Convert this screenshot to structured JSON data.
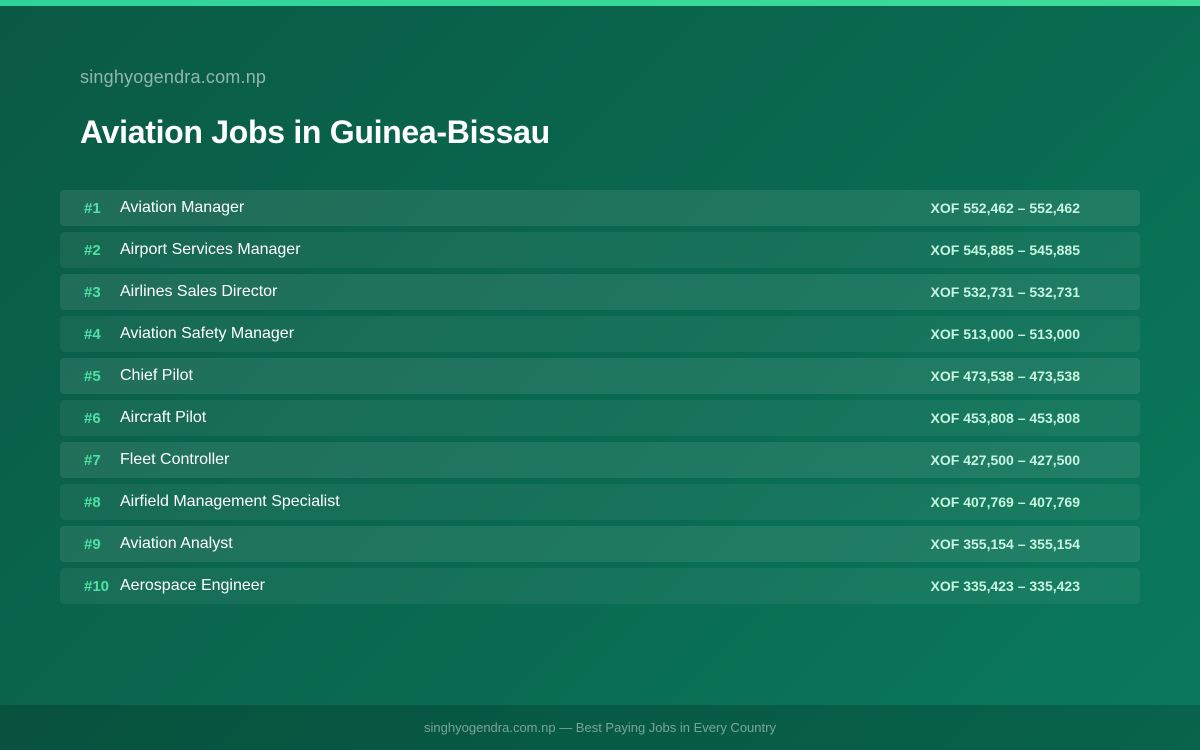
{
  "header": {
    "site_name": "singhyogendra.com.np",
    "title": "Aviation Jobs in Guinea-Bissau"
  },
  "jobs": [
    {
      "rank": "#1",
      "title": "Aviation Manager",
      "salary": "XOF 552,462 – 552,462"
    },
    {
      "rank": "#2",
      "title": "Airport Services Manager",
      "salary": "XOF 545,885 – 545,885"
    },
    {
      "rank": "#3",
      "title": "Airlines Sales Director",
      "salary": "XOF 532,731 – 532,731"
    },
    {
      "rank": "#4",
      "title": "Aviation Safety Manager",
      "salary": "XOF 513,000 – 513,000"
    },
    {
      "rank": "#5",
      "title": "Chief Pilot",
      "salary": "XOF 473,538 – 473,538"
    },
    {
      "rank": "#6",
      "title": "Aircraft Pilot",
      "salary": "XOF 453,808 – 453,808"
    },
    {
      "rank": "#7",
      "title": "Fleet Controller",
      "salary": "XOF 427,500 – 427,500"
    },
    {
      "rank": "#8",
      "title": "Airfield Management Specialist",
      "salary": "XOF 407,769 – 407,769"
    },
    {
      "rank": "#9",
      "title": "Aviation Analyst",
      "salary": "XOF 355,154 – 355,154"
    },
    {
      "rank": "#10",
      "title": "Aerospace Engineer",
      "salary": "XOF 335,423 – 335,423"
    }
  ],
  "footer": {
    "text": "singhyogendra.com.np — Best Paying Jobs in Every Country"
  },
  "colors": {
    "accent": "#3ddc97",
    "background": "#096a50"
  }
}
